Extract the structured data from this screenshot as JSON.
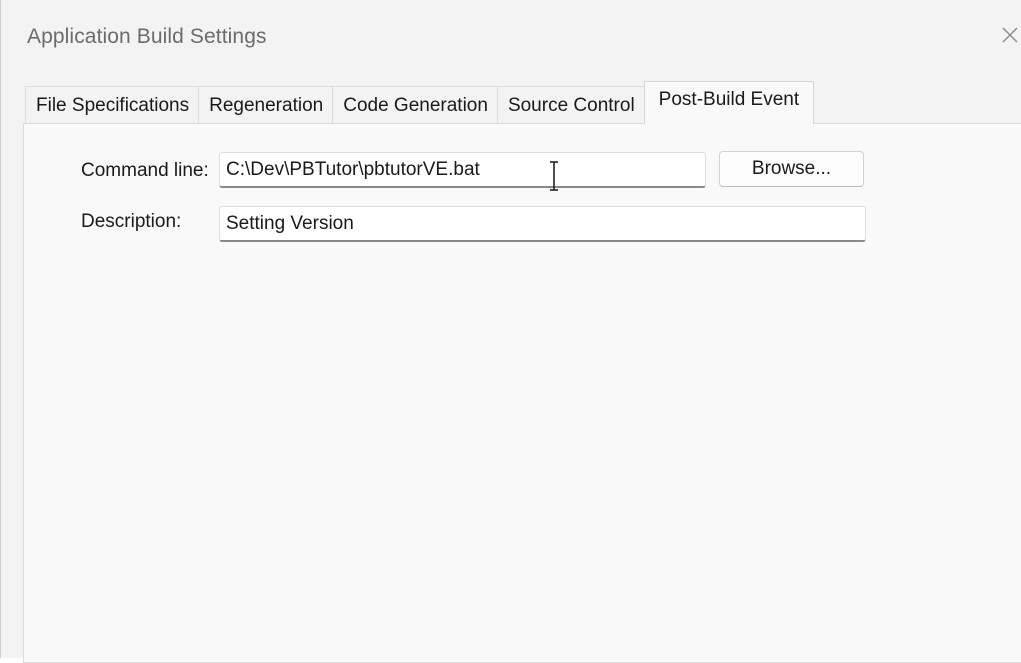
{
  "window": {
    "title": "Application Build Settings",
    "close_icon": "close-icon"
  },
  "tabs": [
    {
      "label": "File Specifications",
      "active": false
    },
    {
      "label": "Regeneration",
      "active": false
    },
    {
      "label": "Code Generation",
      "active": false
    },
    {
      "label": "Source Control",
      "active": false
    },
    {
      "label": "Post-Build Event",
      "active": true
    }
  ],
  "post_build": {
    "command_line_label": "Command line:",
    "command_line_value": "C:\\Dev\\PBTutor\\pbtutorVE.bat",
    "browse_label": "Browse...",
    "description_label": "Description:",
    "description_value": "Setting Version"
  },
  "colors": {
    "window_bg": "#f3f3f3",
    "panel_bg": "#f9f9f9",
    "title_text": "#6b6b6b",
    "text": "#1a1a1a"
  },
  "mouse_cursor": "i-beam-cursor-icon"
}
